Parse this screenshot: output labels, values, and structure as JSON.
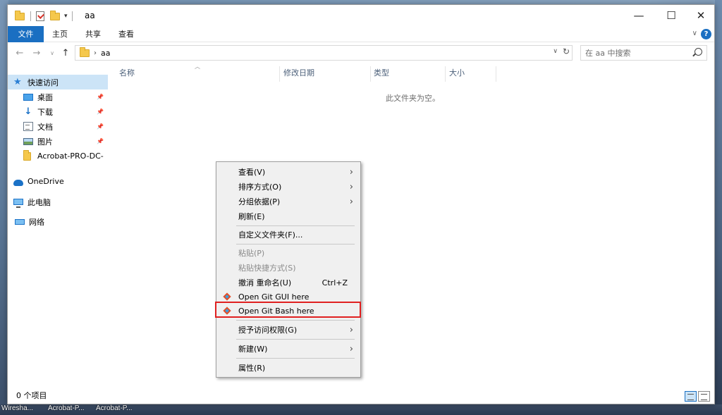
{
  "window": {
    "title": "aa",
    "controls": {
      "minimize": "—",
      "maximize": "☐",
      "close": "✕"
    }
  },
  "ribbon": {
    "tabs": [
      "文件",
      "主页",
      "共享",
      "查看"
    ],
    "help": "?"
  },
  "address": {
    "path": [
      "aa"
    ],
    "search_placeholder": "在 aa 中搜索"
  },
  "sidebar": {
    "items": [
      {
        "label": "快速访问",
        "icon": "star-icon",
        "pinned": false
      },
      {
        "label": "桌面",
        "icon": "desktop-icon",
        "pinned": true
      },
      {
        "label": "下载",
        "icon": "download-icon",
        "pinned": true
      },
      {
        "label": "文档",
        "icon": "document-icon",
        "pinned": true
      },
      {
        "label": "图片",
        "icon": "pictures-icon",
        "pinned": true
      },
      {
        "label": "Acrobat-PRO-DC-",
        "icon": "folder-icon",
        "pinned": false
      },
      {
        "label": "OneDrive",
        "icon": "onedrive-icon",
        "pinned": false
      },
      {
        "label": "此电脑",
        "icon": "this-pc-icon",
        "pinned": false
      },
      {
        "label": "网络",
        "icon": "network-icon",
        "pinned": false
      }
    ]
  },
  "content": {
    "columns": [
      "名称",
      "修改日期",
      "类型",
      "大小"
    ],
    "empty_message": "此文件夹为空。"
  },
  "status": {
    "item_count": "0 个项目"
  },
  "context_menu": {
    "items": [
      {
        "label": "查看(V)",
        "submenu": true
      },
      {
        "label": "排序方式(O)",
        "submenu": true
      },
      {
        "label": "分组依据(P)",
        "submenu": true
      },
      {
        "label": "刷新(E)"
      },
      {
        "label": "自定义文件夹(F)..."
      },
      {
        "label": "粘贴(P)",
        "disabled": true
      },
      {
        "label": "粘贴快捷方式(S)",
        "disabled": true
      },
      {
        "label": "撤消 重命名(U)",
        "shortcut": "Ctrl+Z"
      },
      {
        "label": "Open Git GUI here",
        "icon": "git-icon"
      },
      {
        "label": "Open Git Bash here",
        "icon": "git-icon",
        "highlighted": true
      },
      {
        "label": "授予访问权限(G)",
        "submenu": true
      },
      {
        "label": "新建(W)",
        "submenu": true
      },
      {
        "label": "属性(R)"
      }
    ],
    "highlight_color": "#e02020"
  },
  "taskbar": {
    "items": [
      "Wiresha...",
      "Acrobat-P...",
      "Acrobat-P..."
    ]
  },
  "colors": {
    "accent": "#1a6fc2",
    "selection": "#cce4f7"
  }
}
